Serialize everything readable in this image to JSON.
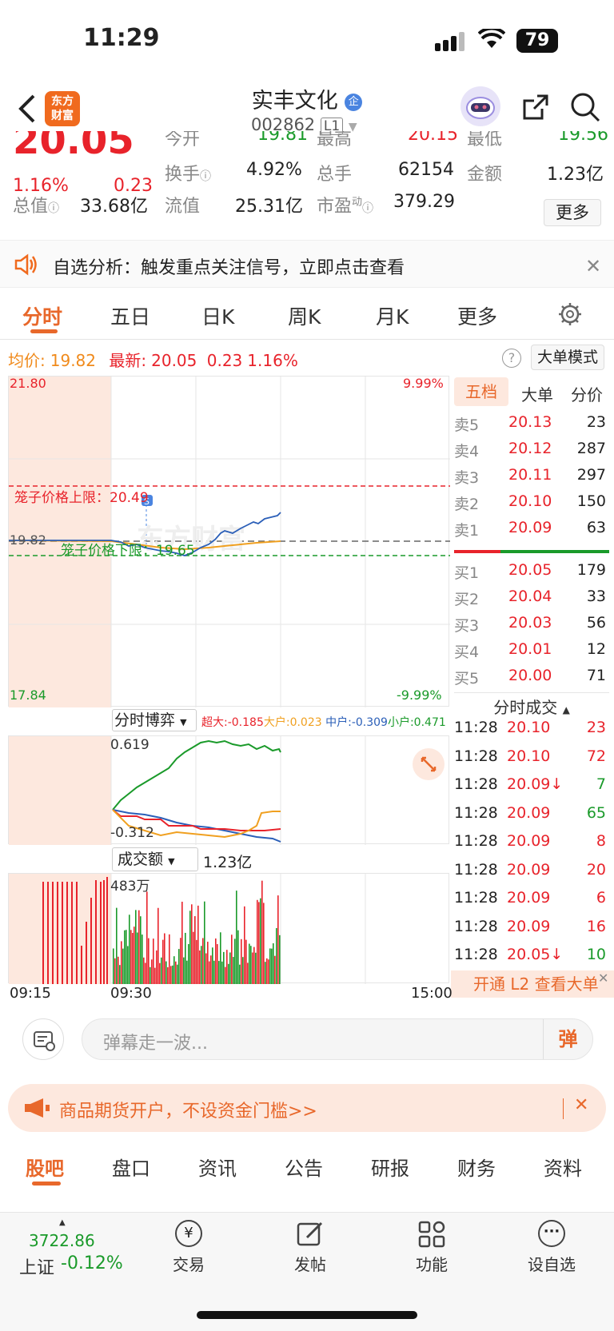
{
  "status": {
    "time": "11:29",
    "battery": "79"
  },
  "header": {
    "logo_text": "东方\n财富",
    "name": "实丰文化",
    "name_badge": "企",
    "code": "002862",
    "level": "L1"
  },
  "quote": {
    "price": "20.05",
    "change_pct": "1.16%",
    "change_amt": "0.23",
    "open_label": "今开",
    "open": "19.81",
    "high_label": "最高",
    "high": "20.15",
    "low_label": "最低",
    "low": "19.56",
    "turnover_label": "换手",
    "turnover": "4.92%",
    "volume_label": "总手",
    "volume": "62154",
    "amount_label": "金额",
    "amount": "1.23亿",
    "mktcap_label": "总值",
    "mktcap": "33.68亿",
    "float_label": "流值",
    "float": "25.31亿",
    "pe_label": "市盈",
    "pe_sup": "动",
    "pe": "379.29",
    "more": "更多"
  },
  "notice": {
    "text": "自选分析：触发重点关注信号，立即点击查看"
  },
  "tabs": [
    "分时",
    "五日",
    "日K",
    "周K",
    "月K",
    "更多"
  ],
  "info": {
    "avg_label": "均价:",
    "avg": "19.82",
    "latest_label": "最新:",
    "latest": "20.05",
    "chg": "0.23",
    "pct": "1.16%",
    "mode": "大单模式"
  },
  "chart": {
    "ymax": "21.80",
    "ymin": "17.84",
    "pmax": "9.99%",
    "pmin": "-9.99%",
    "ref": "19.82",
    "upper_label": "笼子价格上限：",
    "upper": "20.49",
    "lower_label": "笼子价格下限：",
    "lower": "19.65",
    "game_label": "分时博弈",
    "game_legend": [
      {
        "t": "超大:-0.185",
        "c": "#e8232b"
      },
      {
        "t": "大户:0.023",
        "c": "#f0a020"
      },
      {
        "t": "中户:-0.309",
        "c": "#2b5fb8"
      },
      {
        "t": "小户:0.471",
        "c": "#1a9a2a"
      }
    ],
    "game_max": "0.619",
    "game_min": "-0.312",
    "vol_label": "成交额",
    "vol_total": "1.23亿",
    "vol_max": "483万",
    "t_start": "09:15",
    "t_mid": "09:30",
    "t_end": "15:00"
  },
  "orderbook": {
    "tabs": [
      "五档",
      "大单",
      "分价"
    ],
    "asks": [
      {
        "l": "卖5",
        "p": "20.13",
        "v": "23"
      },
      {
        "l": "卖4",
        "p": "20.12",
        "v": "287"
      },
      {
        "l": "卖3",
        "p": "20.11",
        "v": "297"
      },
      {
        "l": "卖2",
        "p": "20.10",
        "v": "150"
      },
      {
        "l": "卖1",
        "p": "20.09",
        "v": "63"
      }
    ],
    "bids": [
      {
        "l": "买1",
        "p": "20.05",
        "v": "179"
      },
      {
        "l": "买2",
        "p": "20.04",
        "v": "33"
      },
      {
        "l": "买3",
        "p": "20.03",
        "v": "56"
      },
      {
        "l": "买4",
        "p": "20.01",
        "v": "12"
      },
      {
        "l": "买5",
        "p": "20.00",
        "v": "71"
      }
    ],
    "trades_title": "分时成交",
    "trades": [
      {
        "t": "11:28",
        "p": "20.10",
        "v": "23",
        "c": "red"
      },
      {
        "t": "11:28",
        "p": "20.10",
        "v": "72",
        "c": "red"
      },
      {
        "t": "11:28",
        "p": "20.09↓",
        "v": "7",
        "c": "green"
      },
      {
        "t": "11:28",
        "p": "20.09",
        "v": "65",
        "c": "green"
      },
      {
        "t": "11:28",
        "p": "20.09",
        "v": "8",
        "c": "red"
      },
      {
        "t": "11:28",
        "p": "20.09",
        "v": "20",
        "c": "red"
      },
      {
        "t": "11:28",
        "p": "20.09",
        "v": "6",
        "c": "red"
      },
      {
        "t": "11:28",
        "p": "20.09",
        "v": "16",
        "c": "red"
      },
      {
        "t": "11:28",
        "p": "20.05↓",
        "v": "10",
        "c": "green"
      }
    ],
    "l2": "开通 L2 查看大单"
  },
  "danmu": {
    "placeholder": "弹幕走一波...",
    "btn": "弹"
  },
  "promo": {
    "text": "商品期货开户，不设资金门槛>>"
  },
  "bottom_tabs": [
    "股吧",
    "盘口",
    "资讯",
    "公告",
    "研报",
    "财务",
    "资料"
  ],
  "nav": {
    "index_value": "3722.86",
    "index_name": "上证",
    "index_chg": "-0.12%",
    "items": [
      "交易",
      "发帖",
      "功能",
      "设自选"
    ]
  }
}
